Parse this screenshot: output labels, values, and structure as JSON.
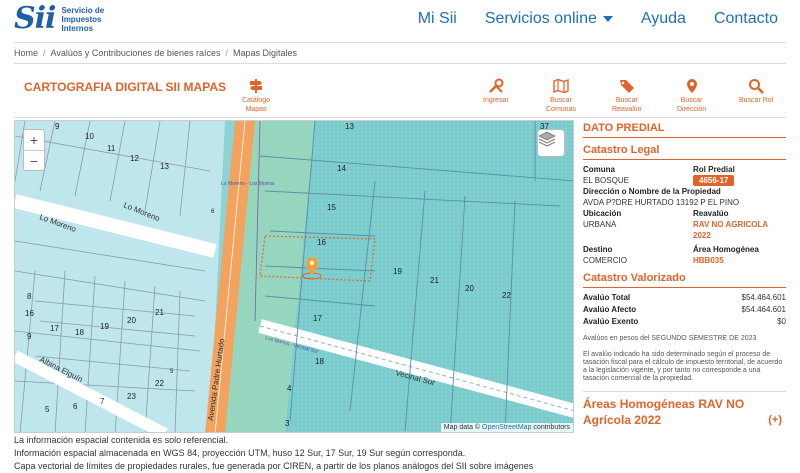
{
  "header": {
    "logo_mark": "Sii",
    "logo_lines": [
      "Servicio de",
      "Impuestos",
      "Internos"
    ],
    "nav": [
      "Mi Sii",
      "Servicios online",
      "Ayuda",
      "Contacto"
    ]
  },
  "breadcrumb": [
    "Home",
    "Avalúos y Contribuciones de bienes raíces",
    "Mapas Digitales"
  ],
  "title": "CARTOGRAFIA DIGITAL SII MAPAS",
  "tools": {
    "catalogo": [
      "Catálogo",
      "Mapas"
    ],
    "ingresar": "Ingresar",
    "buscar_comunas": [
      "Buscar",
      "Comunas"
    ],
    "buscar_reavaluo": [
      "Buscar",
      "Reavalúo"
    ],
    "buscar_direccion": [
      "Buscar",
      "Dirección"
    ],
    "buscar_rol": "Buscar Rol"
  },
  "map": {
    "zoom_in": "+",
    "zoom_out": "−",
    "attribution_prefix": "Map data ©",
    "attribution_link": "OpenStreetMap",
    "attribution_suffix": "contributors",
    "streets": [
      "Lo Moreno",
      "Lo Moreno",
      "Albina Elguín",
      "Avenida Padre Hurtado",
      "Vecinal Sur",
      "Lo Moreno - Los Morros",
      "Los Morros - Vecinal Sur"
    ],
    "lot_numbers": [
      "13",
      "14",
      "15",
      "16",
      "17",
      "18",
      "19",
      "21",
      "20",
      "22",
      "37",
      "9",
      "10",
      "11",
      "12",
      "13",
      "8",
      "9",
      "16",
      "17",
      "18",
      "19",
      "20",
      "21",
      "22",
      "23",
      "7",
      "6",
      "5",
      "4",
      "3",
      "6",
      "5",
      "12957",
      "3035"
    ]
  },
  "notes": [
    "La información espacial contenida es solo referencial.",
    "Información espacial almacenada en WGS 84, proyección UTM, huso 12 Sur, 17 Sur, 19 Sur según corresponda.",
    "Capa vectorial de límites de propiedades rurales, fue generada por CIREN, a partir de los planos análogos del SII sobre imágenes"
  ],
  "panel": {
    "h_dato": "DATO PREDIAL",
    "h_legal": "Catastro Legal",
    "comuna_label": "Comuna",
    "comuna_value": "EL BOSQUE",
    "rol_label": "Rol Predial",
    "rol_value": "4656-17",
    "direccion_label": "Dirección o Nombre de la Propiedad",
    "direccion_value": "AVDA P?DRE HURTADO 13192 P EL PINO",
    "ubicacion_label": "Ubicación",
    "ubicacion_value": "URBANA",
    "reavaluo_label": "Reavalúo",
    "reavaluo_value": "RAV NO AGRICOLA 2022",
    "destino_label": "Destino",
    "destino_value": "COMERCIO",
    "area_label": "Área Homogénea",
    "area_value": "HBB035",
    "h_valorizado": "Catastro Valorizado",
    "total_label": "Avalúo Total",
    "total_value": "$54.464.601",
    "afecto_label": "Avalúo Afecto",
    "afecto_value": "$54.464.601",
    "exento_label": "Avalúo Exento",
    "exento_value": "$0",
    "note1": "Avalúos en pesos del SEGUNDO SEMESTRE DE 2023",
    "note2": "El avalúo indicado ha sido determinado según el proceso de tasación fiscal para el cálculo de impuesto territorial, de acuerdo a la legislación vigente, y por tanto no corresponde a una tasación comercial de la propiedad.",
    "h_areas": "Áreas Homogéneas RAV NO Agrícola 2022",
    "h_areas_toggle": "(+)"
  },
  "colors": {
    "accent": "#e0642a",
    "link": "#1f6fb8",
    "map_fill": "#8dd3d3",
    "road": "#f3a35d"
  }
}
